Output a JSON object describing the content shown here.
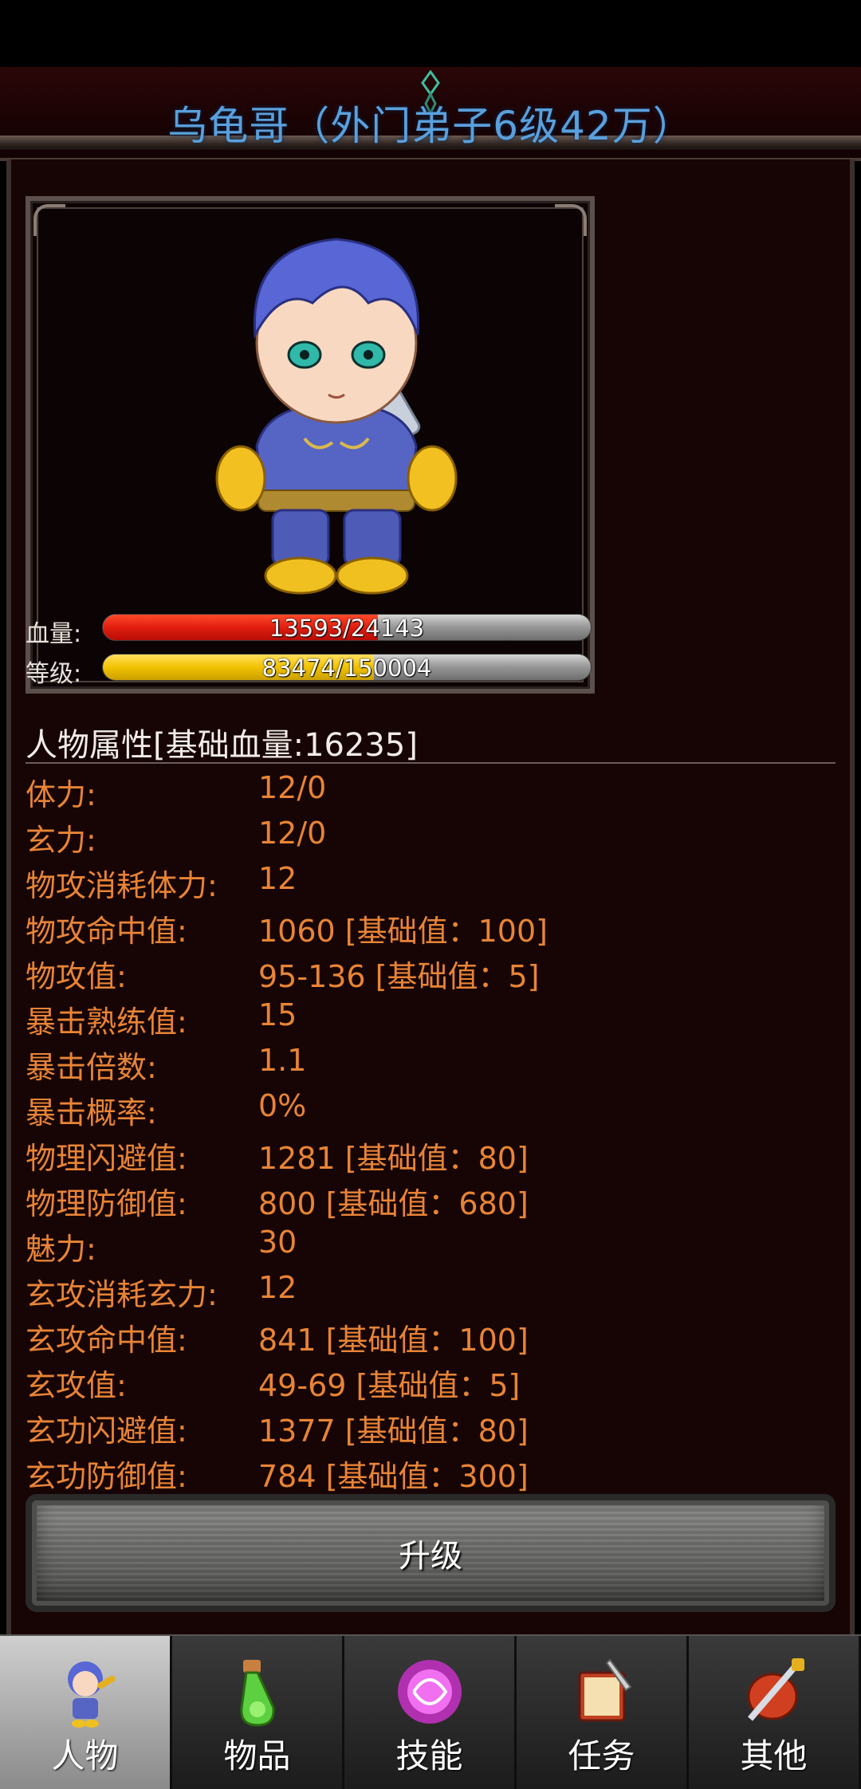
{
  "header": {
    "title": "乌龟哥（外门弟子6级42万）"
  },
  "character": {
    "hp": {
      "label": "血量:",
      "text": "13593/24143",
      "fraction": 0.563
    },
    "level": {
      "label": "等级:",
      "text": "83474/150004",
      "fraction": 0.556
    }
  },
  "attributes": {
    "header": "人物属性[基础血量:16235]",
    "rows": [
      {
        "label": "体力:",
        "value": "12/0"
      },
      {
        "label": "玄力:",
        "value": "12/0"
      },
      {
        "label": "物攻消耗体力:",
        "value": "12"
      },
      {
        "label": "物攻命中值:",
        "value": "1060 [基础值：100]"
      },
      {
        "label": "物攻值:",
        "value": "95-136 [基础值：5]"
      },
      {
        "label": "暴击熟练值:",
        "value": "15"
      },
      {
        "label": "暴击倍数:",
        "value": "1.1"
      },
      {
        "label": "暴击概率:",
        "value": "0%"
      },
      {
        "label": "物理闪避值:",
        "value": "1281 [基础值：80]"
      },
      {
        "label": "物理防御值:",
        "value": "800 [基础值：680]"
      },
      {
        "label": "魅力:",
        "value": "30"
      },
      {
        "label": "玄攻消耗玄力:",
        "value": "12"
      },
      {
        "label": "玄攻命中值:",
        "value": "841 [基础值：100]"
      },
      {
        "label": "玄攻值:",
        "value": "49-69 [基础值：5]"
      },
      {
        "label": "玄功闪避值:",
        "value": "1377 [基础值：80]"
      },
      {
        "label": "玄功防御值:",
        "value": "784 [基础值：300]"
      }
    ]
  },
  "upgrade_button": {
    "label": "升级"
  },
  "tabs": [
    {
      "label": "人物",
      "icon": "character-icon",
      "active": true
    },
    {
      "label": "物品",
      "icon": "potion-icon",
      "active": false
    },
    {
      "label": "技能",
      "icon": "skill-orb-icon",
      "active": false
    },
    {
      "label": "任务",
      "icon": "quest-book-icon",
      "active": false
    },
    {
      "label": "其他",
      "icon": "sword-shield-icon",
      "active": false
    }
  ],
  "colors": {
    "title": "#5aa0dc",
    "stat_text": "#e88436",
    "hp_bar": "#e01e10",
    "exp_bar": "#f2c200"
  }
}
